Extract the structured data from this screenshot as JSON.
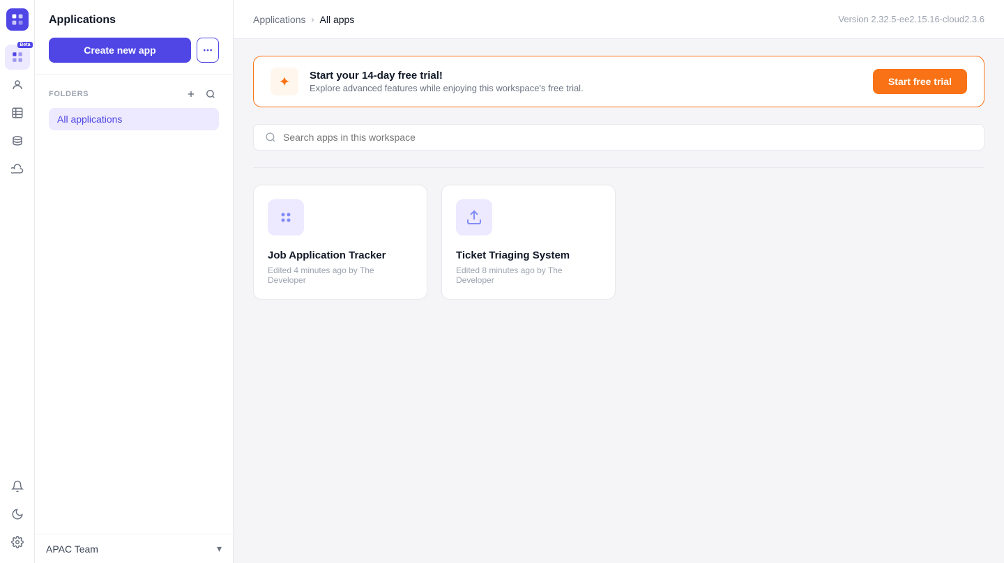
{
  "iconSidebar": {
    "logoAlt": "Tooljet logo",
    "navItems": [
      {
        "name": "apps-icon",
        "label": "Apps",
        "active": true,
        "beta": true
      },
      {
        "name": "users-icon",
        "label": "Users",
        "active": false,
        "beta": false
      },
      {
        "name": "tables-icon",
        "label": "Tables",
        "active": false,
        "beta": false
      },
      {
        "name": "database-icon",
        "label": "Database",
        "active": false,
        "beta": false
      },
      {
        "name": "integrations-icon",
        "label": "Integrations",
        "active": false,
        "beta": false
      }
    ],
    "bottomItems": [
      {
        "name": "notifications-icon",
        "label": "Notifications"
      },
      {
        "name": "theme-icon",
        "label": "Theme"
      },
      {
        "name": "settings-icon",
        "label": "Settings"
      }
    ]
  },
  "leftPanel": {
    "title": "Applications",
    "createButton": "Create new app",
    "foldersLabel": "FOLDERS",
    "folders": [
      {
        "name": "All applications",
        "active": true
      }
    ],
    "workspace": {
      "name": "APAC Team",
      "chevron": "▾"
    }
  },
  "topBar": {
    "breadcrumb": {
      "parent": "Applications",
      "separator": "›",
      "current": "All apps"
    },
    "version": "Version 2.32.5-ee2.15.16-cloud2.3.6"
  },
  "trialBanner": {
    "icon": "✦",
    "title": "Start your 14-day free trial!",
    "subtitle": "Explore advanced features while enjoying this workspace's free trial.",
    "buttonLabel": "Start free trial"
  },
  "search": {
    "placeholder": "Search apps in this workspace"
  },
  "apps": [
    {
      "name": "Job Application Tracker",
      "meta": "Edited 4 minutes ago by The Developer",
      "iconType": "dots"
    },
    {
      "name": "Ticket Triaging System",
      "meta": "Edited 8 minutes ago by The Developer",
      "iconType": "upload"
    }
  ]
}
